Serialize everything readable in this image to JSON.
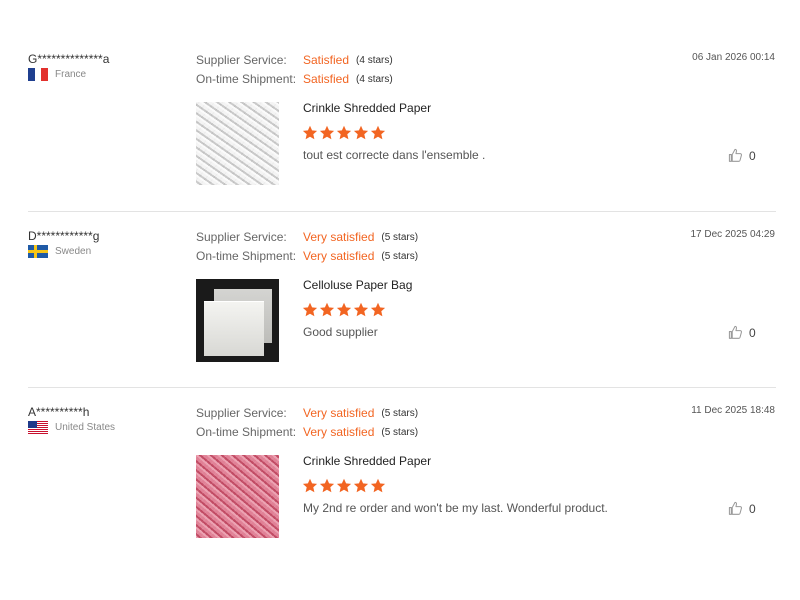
{
  "labels": {
    "supplier_service": "Supplier Service:",
    "ontime_shipment": "On-time Shipment:"
  },
  "reviews": [
    {
      "buyer": "G**************a",
      "country": "France",
      "flag_icon": "france-flag-icon",
      "supplier_rating": "Satisfied",
      "supplier_stars": "(4 stars)",
      "shipment_rating": "Satisfied",
      "shipment_stars": "(4 stars)",
      "date": "06 Jan 2026 00:14",
      "product_title": "Crinkle Shredded Paper",
      "star_rating": 5,
      "comment": "tout est correcte dans l'ensemble .",
      "helpful_count": "0"
    },
    {
      "buyer": "D************g",
      "country": "Sweden",
      "flag_icon": "sweden-flag-icon",
      "supplier_rating": "Very satisfied",
      "supplier_stars": "(5 stars)",
      "shipment_rating": "Very satisfied",
      "shipment_stars": "(5 stars)",
      "date": "17 Dec 2025 04:29",
      "product_title": "Celloluse Paper Bag",
      "star_rating": 5,
      "comment": "Good supplier",
      "helpful_count": "0"
    },
    {
      "buyer": "A**********h",
      "country": "United States",
      "flag_icon": "usa-flag-icon",
      "supplier_rating": "Very satisfied",
      "supplier_stars": "(5 stars)",
      "shipment_rating": "Very satisfied",
      "shipment_stars": "(5 stars)",
      "date": "11 Dec 2025 18:48",
      "product_title": "Crinkle Shredded Paper",
      "star_rating": 5,
      "comment": "My 2nd re order and won't be my last. Wonderful product.",
      "helpful_count": "0"
    }
  ],
  "colors": {
    "accent": "#f26522",
    "divider": "#e3e3e3"
  }
}
